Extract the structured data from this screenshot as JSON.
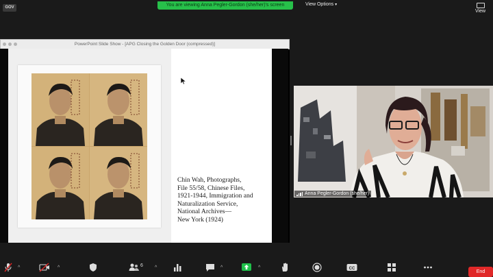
{
  "top_bar": {
    "tag": "GOV",
    "share_banner": "You are viewing Anna Pegler-Gordon (she/her)'s screen",
    "view_options_label": "View Options",
    "view_label": "View"
  },
  "ppt_window": {
    "title": "PowerPoint Slide Show - [APG Closing the Golden Door (compressed)]",
    "caption_lines": [
      "Chin Wah, Photographs,",
      "File 55/58, Chinese Files,",
      "1921-1944, Immigration and",
      "Naturalization Service,",
      "National Archives—",
      "New York (1924)"
    ]
  },
  "video": {
    "participant_name": "Anna Pegler-Gordon (she/her)"
  },
  "toolbar": {
    "participants_count": "6",
    "end_label": "End"
  },
  "colors": {
    "share_green": "#27c04a",
    "share_icon_green": "#1fc04a",
    "end_red": "#e02828"
  },
  "icons": [
    "microphone-muted-icon",
    "video-off-icon",
    "security-shield-icon",
    "participants-icon",
    "polls-icon",
    "chat-icon",
    "share-screen-icon",
    "reactions-hand-icon",
    "record-icon",
    "closed-caption-icon",
    "apps-grid-icon",
    "more-icon"
  ]
}
